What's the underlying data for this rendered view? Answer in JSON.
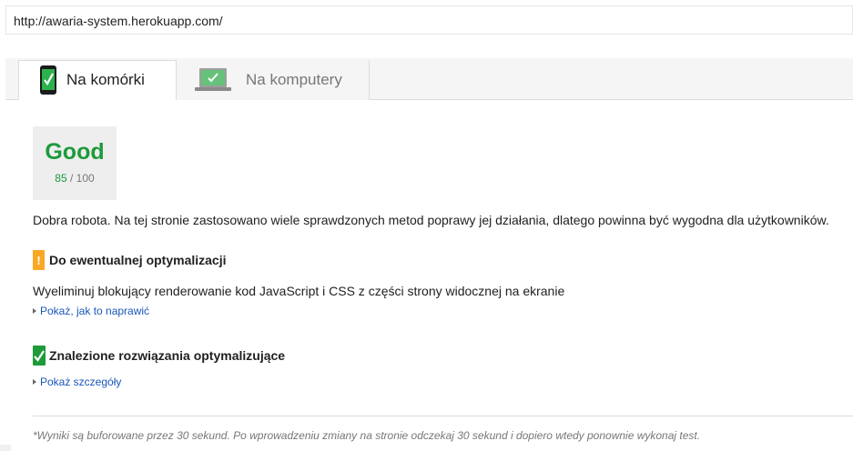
{
  "address_bar": {
    "url": "http://awaria-system.herokuapp.com/"
  },
  "tabs": [
    {
      "label": "Na komórki",
      "icon": "mobile-phone-icon",
      "active": true
    },
    {
      "label": "Na komputery",
      "icon": "laptop-icon",
      "active": false
    }
  ],
  "score": {
    "label": "Good",
    "value": "85",
    "max": "/ 100",
    "color": "#1e9a3b"
  },
  "summary": "Dobra robota. Na tej stronie zastosowano wiele sprawdzonych metod poprawy jej działania, dlatego powinna być wygodna dla użytkowników.",
  "consider_fixing": {
    "badge": "!",
    "badge_color": "#f9a825",
    "heading": "Do ewentualnej optymalizacji",
    "rule": "Wyeliminuj blokujący renderowanie kod JavaScript i CSS z części strony widocznej na ekranie",
    "link": "Pokaż, jak to naprawić"
  },
  "passed": {
    "badge_color": "#1e9a3b",
    "heading": "Znalezione rozwiązania optymalizujące",
    "link": "Pokaż szczegóły"
  },
  "footnote": "*Wyniki są buforowane przez 30 sekund. Po wprowadzeniu zmiany na stronie odczekaj 30 sekund i dopiero wtedy ponownie wykonaj test."
}
